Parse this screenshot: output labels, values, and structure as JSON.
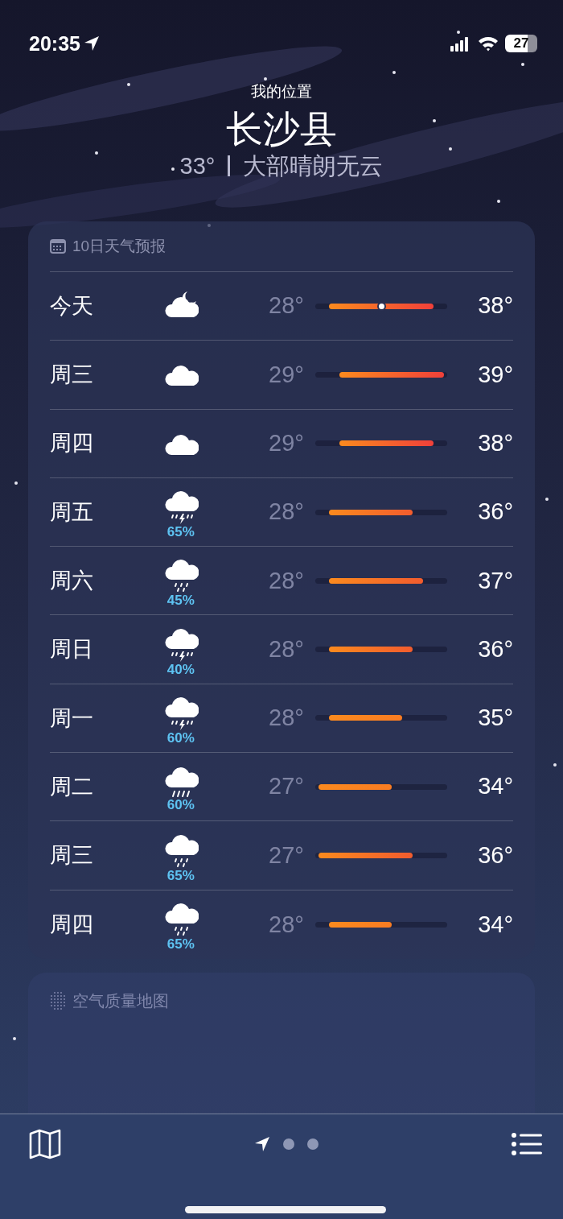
{
  "status_bar": {
    "time": "20:35",
    "location_active": true,
    "battery": "27"
  },
  "header": {
    "subtitle": "我的位置",
    "city": "长沙县",
    "temperature": "33°",
    "condition": "大部晴朗无云"
  },
  "forecast": {
    "title": "10日天气预报",
    "days": [
      {
        "day": "今天",
        "kind": "partly_cloudy_night",
        "low": "28°",
        "high": "38°",
        "current_marker": true
      },
      {
        "day": "周三",
        "kind": "cloudy",
        "low": "29°",
        "high": "39°",
        "current_marker": false
      },
      {
        "day": "周四",
        "kind": "cloudy",
        "low": "29°",
        "high": "38°",
        "current_marker": false
      },
      {
        "day": "周五",
        "kind": "thunderstorm",
        "precipitation": "65%",
        "low": "28°",
        "high": "36°",
        "current_marker": false
      },
      {
        "day": "周六",
        "kind": "rain",
        "precipitation": "45%",
        "low": "28°",
        "high": "37°",
        "current_marker": false
      },
      {
        "day": "周日",
        "kind": "thunderstorm",
        "precipitation": "40%",
        "low": "28°",
        "high": "36°",
        "current_marker": false
      },
      {
        "day": "周一",
        "kind": "thunderstorm",
        "precipitation": "60%",
        "low": "28°",
        "high": "35°",
        "current_marker": false
      },
      {
        "day": "周二",
        "kind": "heavy_rain",
        "precipitation": "60%",
        "low": "27°",
        "high": "34°",
        "current_marker": false
      },
      {
        "day": "周三",
        "kind": "rain",
        "precipitation": "65%",
        "low": "27°",
        "high": "36°",
        "current_marker": false
      },
      {
        "day": "周四",
        "kind": "rain",
        "precipitation": "65%",
        "low": "28°",
        "high": "34°",
        "current_marker": false
      }
    ]
  },
  "air_quality_map": {
    "title": "空气质量地图"
  },
  "tab_bar": {
    "pages": [
      {
        "kind": "location",
        "selected": true
      },
      {
        "kind": "dot",
        "selected": false
      },
      {
        "kind": "dot",
        "selected": false
      }
    ]
  }
}
